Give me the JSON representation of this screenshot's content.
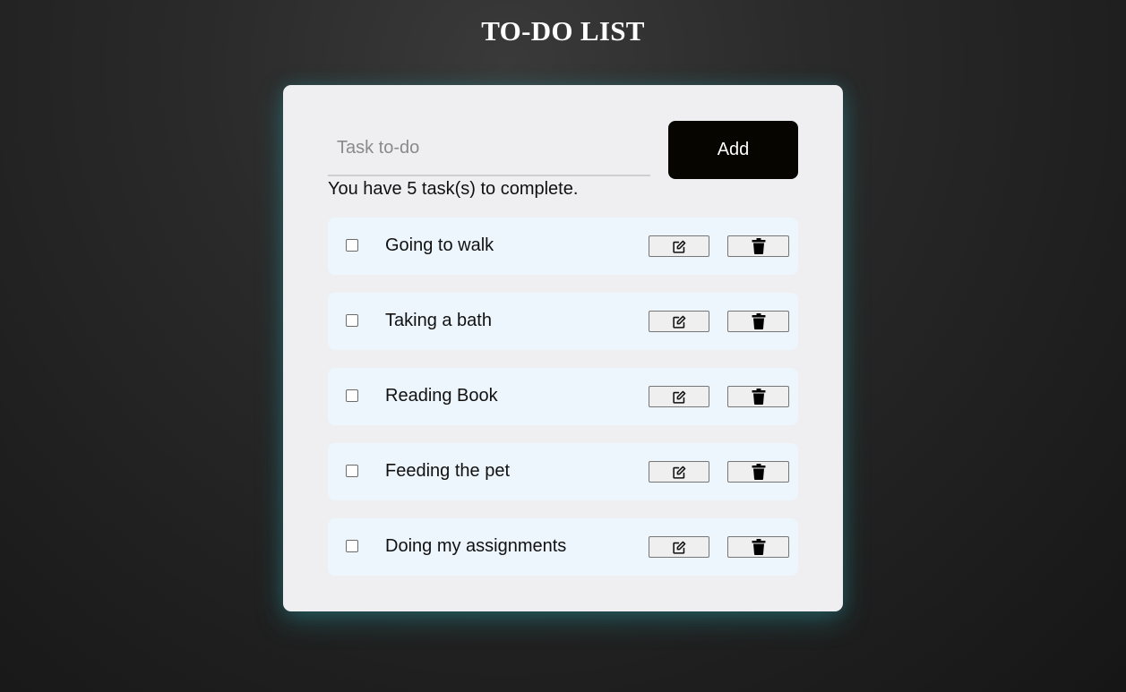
{
  "header": {
    "title": "TO-DO LIST"
  },
  "form": {
    "input_placeholder": "Task to-do",
    "input_value": "",
    "add_label": "Add"
  },
  "summary": {
    "text": "You have 5 task(s) to complete."
  },
  "tasks": [
    {
      "label": "Going to walk",
      "checked": false,
      "edit_icon": "edit-icon",
      "delete_icon": "trash-icon"
    },
    {
      "label": "Taking a bath",
      "checked": false,
      "edit_icon": "edit-icon",
      "delete_icon": "trash-icon"
    },
    {
      "label": "Reading Book",
      "checked": false,
      "edit_icon": "edit-icon",
      "delete_icon": "trash-icon"
    },
    {
      "label": "Feeding the pet",
      "checked": false,
      "edit_icon": "edit-icon",
      "delete_icon": "trash-icon"
    },
    {
      "label": "Doing my assignments",
      "checked": false,
      "edit_icon": "edit-icon",
      "delete_icon": "trash-icon"
    }
  ],
  "colors": {
    "background": "#222222",
    "card": "#efeff2",
    "task_row": "#eef6fd",
    "add_button": "#060500",
    "card_glow": "#28a0aa"
  }
}
